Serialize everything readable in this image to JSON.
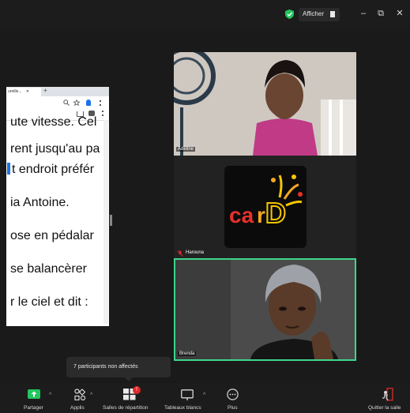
{
  "titlebar": {
    "view_label": "Afficher",
    "icons": [
      "shield-check-icon",
      "grid-icon",
      "minimize-icon",
      "restore-icon",
      "close-icon"
    ],
    "minimize": "–",
    "restore": "⧉",
    "close": "✕"
  },
  "shared_screen": {
    "tab_title": "ureille...",
    "tab_close": "✕",
    "new_tab": "+",
    "lines": [
      "ute vitesse. Cel",
      "rent jusqu'au pa",
      "t endroit préfér",
      "ia Antoine.",
      "ose en pédalar",
      "se balancèrer",
      "r le ciel et dit :"
    ]
  },
  "participants": [
    {
      "name": "Adéline"
    },
    {
      "name": "Harouna",
      "muted": true,
      "logo_text": "carD"
    },
    {
      "name": "Brenda",
      "active_speaker": true
    }
  ],
  "tooltip": {
    "text": "7 participants non affectés"
  },
  "toolbar": {
    "items": [
      {
        "label": "Partager",
        "icon": "share-screen-icon"
      },
      {
        "label": "Applis",
        "icon": "apps-icon"
      },
      {
        "label": "Salles de répartition",
        "icon": "breakout-rooms-icon",
        "badge": "!"
      },
      {
        "label": "Tableaux blancs",
        "icon": "whiteboard-icon"
      },
      {
        "label": "Plus",
        "icon": "more-icon"
      },
      {
        "label": "Quitter la salle",
        "icon": "leave-room-icon"
      }
    ]
  },
  "colors": {
    "accent_green": "#3dd68c",
    "share_green": "#22c55e",
    "badge_red": "#e02828",
    "leave_red": "#e02828",
    "logo_red": "#e8302a",
    "logo_orange": "#f5a623",
    "logo_yellow": "#f7c600"
  }
}
